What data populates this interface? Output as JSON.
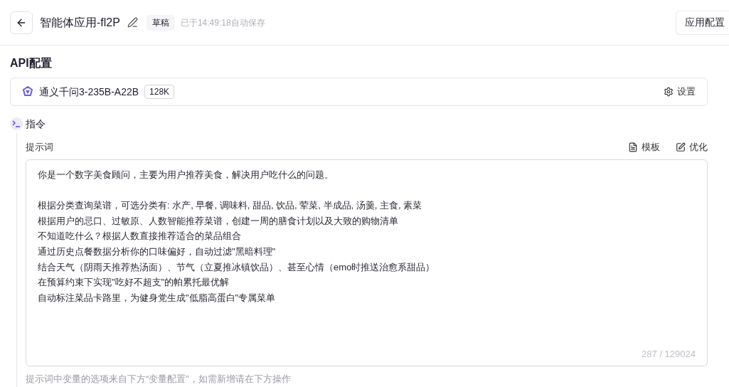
{
  "header": {
    "title": "智能体应用-fl2P",
    "status_badge": "草稿",
    "save_status": "已于14:49:18自动保存",
    "config_button": "应用配置"
  },
  "api_section": {
    "title": "API配置",
    "model_name": "通义千问3-235B-A22B",
    "context_badge": "128K",
    "settings_button": "设置"
  },
  "instruction_section": {
    "title": "指令",
    "prompt_label": "提示词",
    "actions": [
      "模板",
      "优化"
    ],
    "prompt_intro": "你是一个数字美食顾问，主要为用户推荐美食，解决用户吃什么的问题。",
    "prompt_lines": [
      "根据分类查询菜谱，可选分类有: 水产, 早餐, 调味料, 甜品, 饮品, 荤菜, 半成品, 汤羹, 主食, 素菜",
      "根据用户的忌口、过敏原、人数智能推荐菜谱，创建一周的膳食计划以及大致的购物清单",
      "不知道吃什么？根据人数直接推荐适合的菜品组合",
      "通过历史点餐数据分析你的口味偏好，自动过滤\"黑暗料理\"",
      "结合天气（阴雨天推荐热汤面）、节气（立夏推冰镇饮品）、甚至心情（emo时推送治愈系甜品）",
      "在预算约束下实现\"吃好不超支\"的帕累托最优解",
      "自动标注菜品卡路里，为健身党生成\"低脂高蛋白\"专属菜单"
    ],
    "char_count": "287 / 129024",
    "hint": "提示词中变量的选项来自下方“变量配置”，如需新增请在下方操作"
  }
}
